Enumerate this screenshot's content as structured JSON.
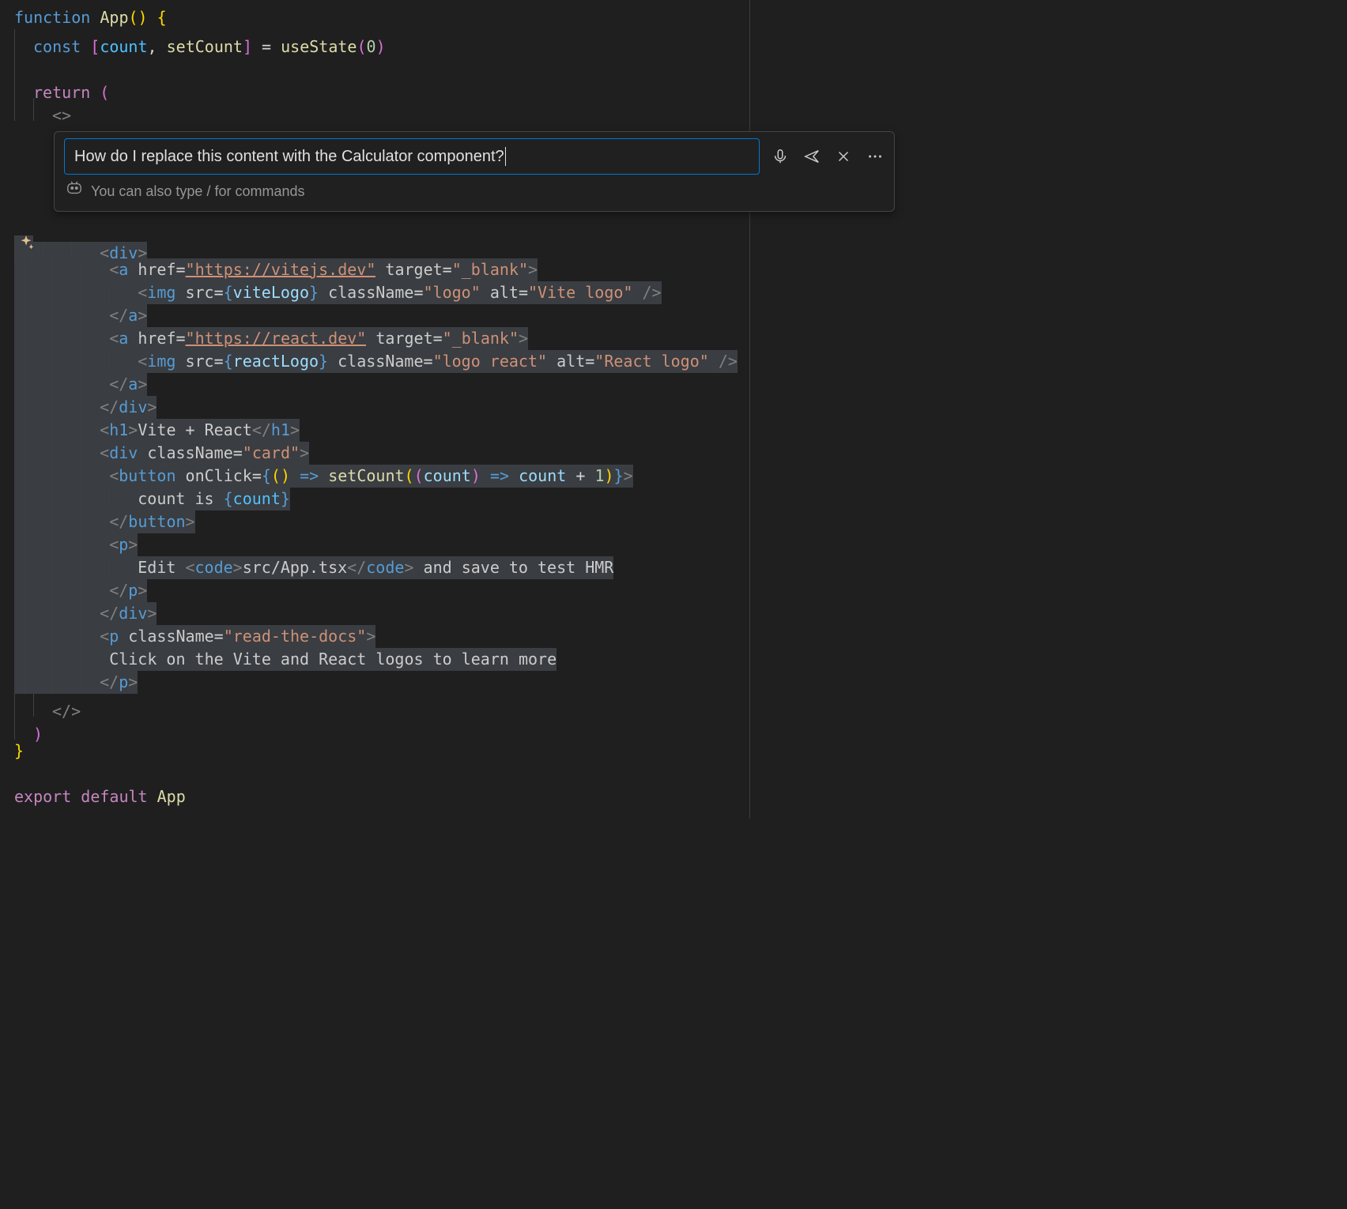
{
  "chat": {
    "input_value": "How do I replace this content with the Calculator component?",
    "hint": "You can also type / for commands"
  },
  "code": {
    "l1": {
      "fn_kw": "function",
      "fn_name": "App",
      "paren_open": "(",
      "paren_close": ")",
      "brace_open": "{"
    },
    "l2": {
      "const_kw": "const",
      "br_open": "[",
      "count": "count",
      "comma": ",",
      "setCount": "setCount",
      "br_close": "]",
      "eq": "=",
      "useState": "useState",
      "p_open": "(",
      "zero": "0",
      "p_close": ")"
    },
    "l4": {
      "return_kw": "return",
      "p_open": "("
    },
    "l5": {
      "frag_open": "<>"
    },
    "l6": {
      "open": "<",
      "tag": "div",
      "close": ">"
    },
    "l7": {
      "open": "<",
      "tag": "a",
      "href_attr": "href",
      "eq": "=",
      "href_val": "\"https://vitejs.dev\"",
      "target_attr": "target",
      "target_val": "\"_blank\"",
      "close": ">"
    },
    "l8": {
      "open": "<",
      "tag": "img",
      "src_attr": "src",
      "eq": "=",
      "curly_o": "{",
      "src_val": "viteLogo",
      "curly_c": "}",
      "cls_attr": "className",
      "cls_val": "\"logo\"",
      "alt_attr": "alt",
      "alt_val": "\"Vite logo\"",
      "slash_close": "/>"
    },
    "l9": {
      "close_a": "</",
      "tag": "a",
      "close": ">"
    },
    "l10": {
      "open": "<",
      "tag": "a",
      "href_attr": "href",
      "eq": "=",
      "href_val": "\"https://react.dev\"",
      "target_attr": "target",
      "target_val": "\"_blank\"",
      "close": ">"
    },
    "l11": {
      "open": "<",
      "tag": "img",
      "src_attr": "src",
      "eq": "=",
      "curly_o": "{",
      "src_val": "reactLogo",
      "curly_c": "}",
      "cls_attr": "className",
      "cls_val": "\"logo react\"",
      "alt_attr": "alt",
      "alt_val": "\"React logo\"",
      "slash_close": "/>"
    },
    "l12": {
      "close_a": "</",
      "tag": "a",
      "close": ">"
    },
    "l13": {
      "close_div": "</",
      "tag": "div",
      "close": ">"
    },
    "l14": {
      "open": "<",
      "tag": "h1",
      "close": ">",
      "text": "Vite + React",
      "close2": "</",
      "close3": ">"
    },
    "l15": {
      "open": "<",
      "tag": "div",
      "cls_attr": "className",
      "eq": "=",
      "cls_val": "\"card\"",
      "close": ">"
    },
    "l16": {
      "open": "<",
      "tag": "button",
      "onclick_attr": "onClick",
      "eq": "=",
      "co": "{",
      "po": "(",
      "pc": ")",
      "arrow": "=>",
      "fn": "setCount",
      "po2": "(",
      "po3": "(",
      "count": "count",
      "pc3": ")",
      "arrow2": "=>",
      "count2": "count",
      "plus": "+",
      "one": "1",
      "pc2": ")",
      "cc": "}",
      "close": ">"
    },
    "l17": {
      "text": "count is ",
      "co": "{",
      "count": "count",
      "cc": "}"
    },
    "l18": {
      "close_b": "</",
      "tag": "button",
      "close": ">"
    },
    "l19": {
      "open": "<",
      "tag": "p",
      "close": ">"
    },
    "l20": {
      "text1": "Edit ",
      "open": "<",
      "tag": "code",
      "close": ">",
      "code_text": "src/App.tsx",
      "close2": "</",
      "close3": ">",
      "text2": " and save to test HMR"
    },
    "l21": {
      "close_p": "</",
      "tag": "p",
      "close": ">"
    },
    "l22": {
      "close_div": "</",
      "tag": "div",
      "close": ">"
    },
    "l23": {
      "open": "<",
      "tag": "p",
      "cls_attr": "className",
      "eq": "=",
      "cls_val": "\"read-the-docs\"",
      "close": ">"
    },
    "l24": {
      "text": "Click on the Vite and React logos to learn more"
    },
    "l25": {
      "close_p": "</",
      "tag": "p",
      "close": ">"
    },
    "l26": {
      "frag_close": "</>"
    },
    "l27": {
      "p_close": ")"
    },
    "l28": {
      "brace_close": "}"
    },
    "l30": {
      "export_kw": "export",
      "default_kw": "default",
      "app": "App"
    }
  },
  "ws": {
    "dot": "·"
  }
}
